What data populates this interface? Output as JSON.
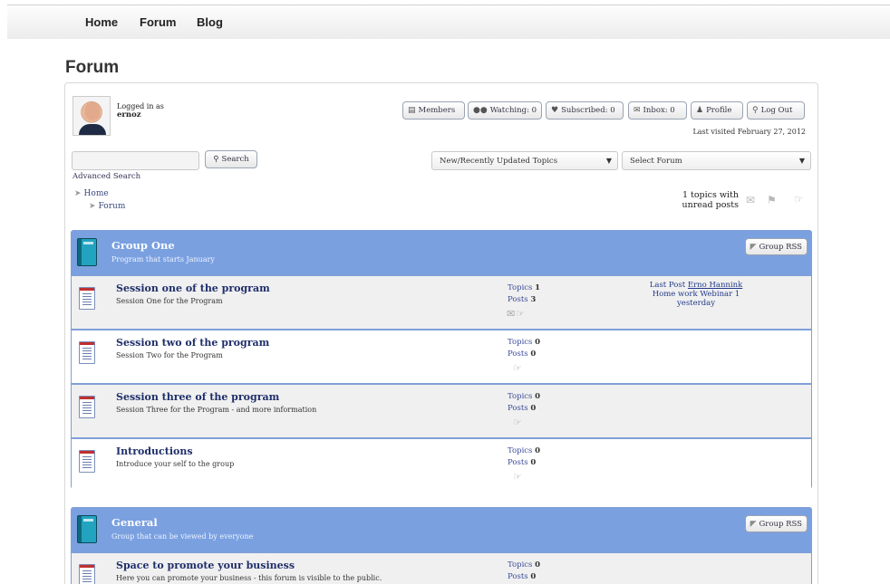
{
  "nav": {
    "items": [
      "Home",
      "Forum",
      "Blog"
    ]
  },
  "page": {
    "title": "Forum"
  },
  "user": {
    "logged_in_label": "Logged in as",
    "name": "ernoz"
  },
  "toolbar": {
    "members": "Members",
    "watching": "Watching: 0",
    "subscribed": "Subscribed: 0",
    "inbox": "Inbox: 0",
    "profile": "Profile",
    "logout": "Log Out",
    "last_visited": "Last visited February 27, 2012"
  },
  "search": {
    "button": "Search",
    "advanced": "Advanced Search",
    "value": ""
  },
  "filters": {
    "topics_select": "New/Recently Updated Topics",
    "forum_select": "Select Forum"
  },
  "breadcrumb": {
    "home": "Home",
    "forum": "Forum"
  },
  "unread": {
    "line1": "1 topics with",
    "line2": "unread posts"
  },
  "groups": [
    {
      "title": "Group One",
      "description": "Program that starts January",
      "rss": "Group RSS",
      "forums": [
        {
          "title": "Session one of the program",
          "description": "Session One for the Program",
          "topics_label": "Topics",
          "topics": "1",
          "posts_label": "Posts",
          "posts": "3",
          "last_post_label": "Last Post",
          "last_post_author": "Erno Hannink",
          "last_post_topic": "Home work Webinar 1",
          "last_post_time": "yesterday"
        },
        {
          "title": "Session two of the program",
          "description": "Session Two for the Program",
          "topics_label": "Topics",
          "topics": "0",
          "posts_label": "Posts",
          "posts": "0"
        },
        {
          "title": "Session three of the program",
          "description": "Session Three for the Program - and more information",
          "topics_label": "Topics",
          "topics": "0",
          "posts_label": "Posts",
          "posts": "0"
        },
        {
          "title": "Introductions",
          "description": "Introduce your self to the group",
          "topics_label": "Topics",
          "topics": "0",
          "posts_label": "Posts",
          "posts": "0"
        }
      ]
    },
    {
      "title": "General",
      "description": "Group that can be viewed by everyone",
      "rss": "Group RSS",
      "forums": [
        {
          "title": "Space to promote your business",
          "description": "Here you can promote your business - this forum is visible to the public.",
          "topics_label": "Topics",
          "topics": "0",
          "posts_label": "Posts",
          "posts": "0"
        }
      ]
    }
  ],
  "icons": {
    "members": "members-icon",
    "watching": "binoculars-icon",
    "subscribed": "heart-icon",
    "inbox": "envelope-icon",
    "profile": "person-icon",
    "logout": "key-icon",
    "search": "magnifier-icon",
    "rss": "rss-icon",
    "group": "book-icon",
    "forum": "document-icon"
  },
  "colors": {
    "group_header": "#7aa0e0",
    "group_border": "#7f9fd8",
    "link": "#1f2f6a"
  }
}
